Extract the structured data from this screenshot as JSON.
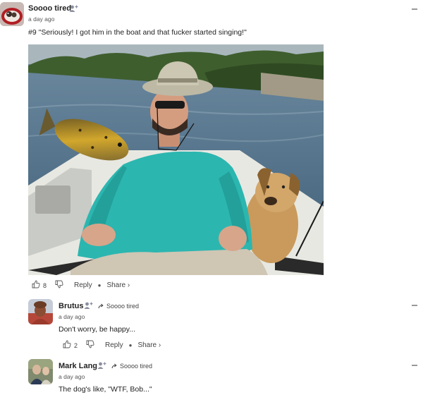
{
  "post": {
    "author": "Soooo tired",
    "timestamp": "a day ago",
    "text": "#9 \"Seriously! I got him in the boat and that fucker started singing!\"",
    "likes": "8",
    "reply_label": "Reply",
    "share_label": "Share ›"
  },
  "replies": [
    {
      "author": "Brutus",
      "reply_to": "Soooo tired",
      "timestamp": "a day ago",
      "text": "Don't worry, be happy...",
      "likes": "2",
      "reply_label": "Reply",
      "share_label": "Share ›"
    },
    {
      "author": "Mark Lang",
      "reply_to": "Soooo tired",
      "timestamp": "a day ago",
      "text": "The dog's like, \"WTF, Bob...\""
    }
  ],
  "colors": {
    "water": "#4f6f86",
    "shirt": "#2cb6b0",
    "dog": "#c99a5b",
    "boat": "#e8e8e2"
  },
  "icons": [
    "add-user-icon",
    "reply-arrow-icon",
    "thumbs-up-icon",
    "thumbs-down-icon",
    "collapse-icon"
  ]
}
